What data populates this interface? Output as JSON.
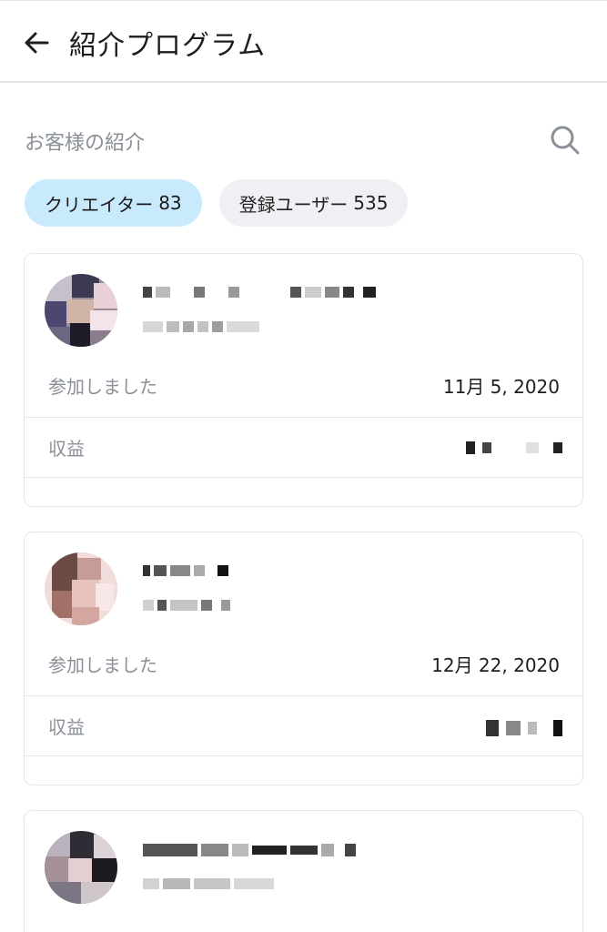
{
  "header": {
    "title": "紹介プログラム",
    "back_icon": "arrow-left-icon"
  },
  "section": {
    "title": "お客様の紹介",
    "search_icon": "search-icon"
  },
  "tabs": [
    {
      "label": "クリエイター",
      "count": "83",
      "active": true
    },
    {
      "label": "登録ユーザー",
      "count": "535",
      "active": false
    }
  ],
  "referrals": [
    {
      "joined_label": "参加しました",
      "joined_date": "11月 5, 2020",
      "revenue_label": "収益"
    },
    {
      "joined_label": "参加しました",
      "joined_date": "12月 22, 2020",
      "revenue_label": "収益"
    },
    {}
  ],
  "colors": {
    "active_chip": "#c9eafc",
    "inactive_chip": "#eef0f3",
    "muted_text": "#8a9097",
    "border": "#e3e6ea"
  }
}
